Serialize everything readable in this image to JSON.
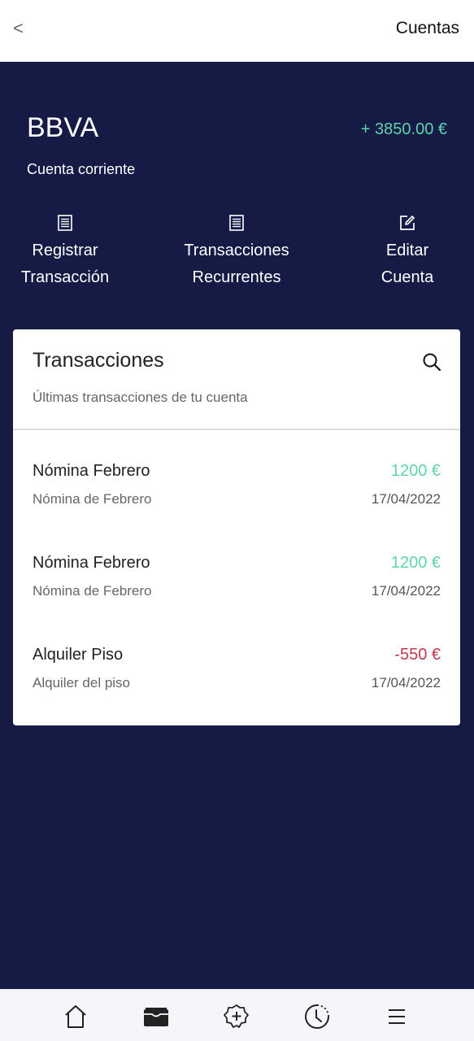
{
  "topbar": {
    "back_label": "<",
    "title": "Cuentas"
  },
  "account": {
    "name": "BBVA",
    "balance": "+ 3850.00 €",
    "type": "Cuenta corriente"
  },
  "actions": [
    {
      "label": "Registrar\nTransacción",
      "icon": "list-icon"
    },
    {
      "label": "Transacciones\nRecurrentes",
      "icon": "list-icon"
    },
    {
      "label": "Editar\nCuenta",
      "icon": "edit-icon"
    }
  ],
  "transactions_card": {
    "title": "Transacciones",
    "subtitle": "Últimas transacciones de tu cuenta",
    "items": [
      {
        "title": "Nómina Febrero",
        "description": "Nómina de Febrero",
        "amount": "1200 €",
        "date": "17/04/2022",
        "type": "income"
      },
      {
        "title": "Nómina Febrero",
        "description": "Nómina de Febrero",
        "amount": "1200 €",
        "date": "17/04/2022",
        "type": "income"
      },
      {
        "title": "Alquiler Piso",
        "description": "Alquiler del piso",
        "amount": "-550 €",
        "date": "17/04/2022",
        "type": "expense"
      }
    ]
  },
  "colors": {
    "background": "#151b45",
    "income": "#5fd3ad",
    "expense": "#c0394b",
    "card": "#ffffff"
  },
  "bottom_nav": [
    {
      "icon": "home-icon"
    },
    {
      "icon": "wallet-icon",
      "active": true
    },
    {
      "icon": "add-circle-icon"
    },
    {
      "icon": "history-icon"
    },
    {
      "icon": "menu-icon"
    }
  ]
}
